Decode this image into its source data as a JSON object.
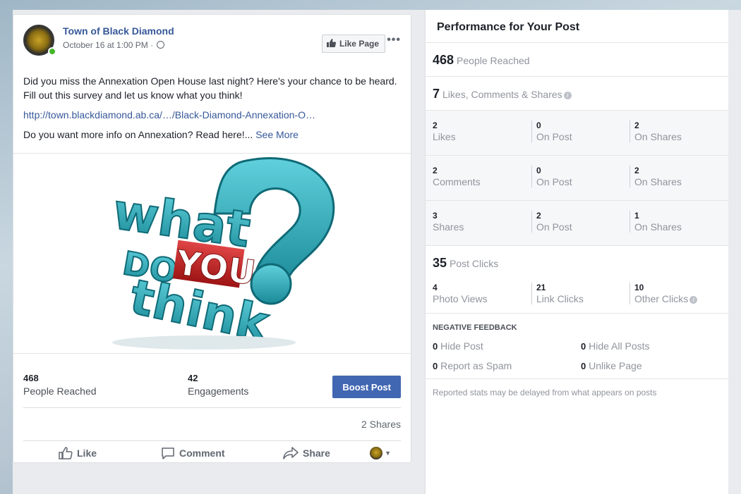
{
  "post": {
    "page_name": "Town of Black Diamond",
    "timestamp": "October 16 at 1:00 PM · ",
    "like_page_label": "Like Page",
    "more_label": "•••",
    "text_line1": "Did you miss the Annexation Open House last night? Here's your chance to be heard. Fill out this survey and let us know what you think!",
    "link": "http://town.blackdiamond.ab.ca/…/Black-Diamond-Annexation-O…",
    "text_line3": "Do you want more info on Annexation? Read here!... ",
    "see_more": "See More",
    "image_text": {
      "word1": "what",
      "word2": "DO",
      "word3": "YOU",
      "word4": "think",
      "mark": "?"
    },
    "stats": {
      "reached_num": "468",
      "reached_label": "People Reached",
      "engagements_num": "42",
      "engagements_label": "Engagements"
    },
    "boost_label": "Boost Post",
    "shares_count": "2 Shares",
    "actions": {
      "like": "Like",
      "comment": "Comment",
      "share": "Share"
    }
  },
  "performance": {
    "title": "Performance for Your Post",
    "reached": {
      "num": "468",
      "label": "People Reached"
    },
    "engagement": {
      "num": "7",
      "label": "Likes, Comments & Shares"
    },
    "rows": [
      {
        "total": "2",
        "total_label": "Likes",
        "on_post": "0",
        "on_post_label": "On Post",
        "on_shares": "2",
        "on_shares_label": "On Shares"
      },
      {
        "total": "2",
        "total_label": "Comments",
        "on_post": "0",
        "on_post_label": "On Post",
        "on_shares": "2",
        "on_shares_label": "On Shares"
      },
      {
        "total": "3",
        "total_label": "Shares",
        "on_post": "2",
        "on_post_label": "On Post",
        "on_shares": "1",
        "on_shares_label": "On Shares"
      }
    ],
    "clicks": {
      "num": "35",
      "label": "Post Clicks",
      "photo_views": "4",
      "photo_views_label": "Photo Views",
      "link_clicks": "21",
      "link_clicks_label": "Link Clicks",
      "other_clicks": "10",
      "other_clicks_label": "Other Clicks"
    },
    "negative": {
      "title": "NEGATIVE FEEDBACK",
      "hide_post": "0",
      "hide_post_label": "Hide Post",
      "hide_all": "0",
      "hide_all_label": "Hide All Posts",
      "spam": "0",
      "spam_label": "Report as Spam",
      "unlike": "0",
      "unlike_label": "Unlike Page"
    },
    "footnote": "Reported stats may be delayed from what appears on posts"
  },
  "colors": {
    "link": "#365899",
    "boost": "#4267b2",
    "online": "#42b72a",
    "teal": "#2fa9b8"
  }
}
